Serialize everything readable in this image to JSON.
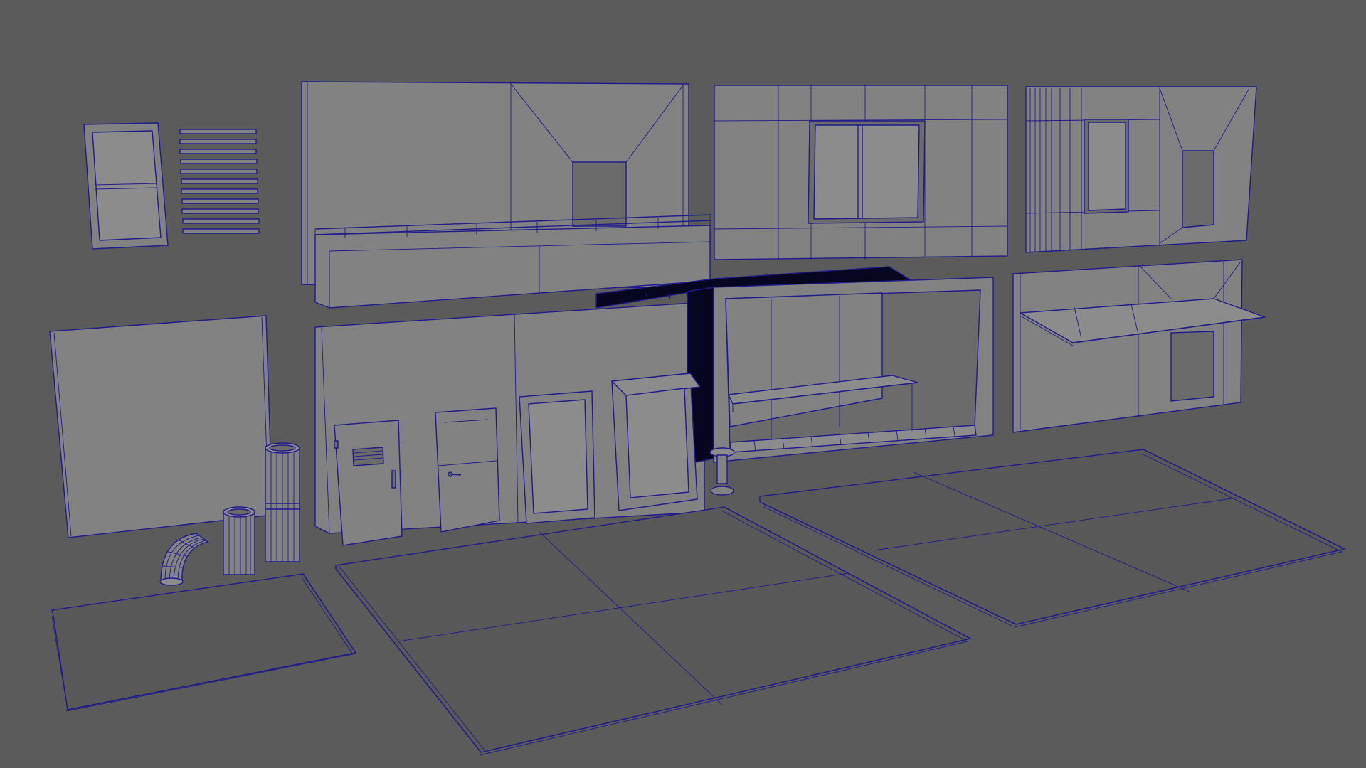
{
  "viewport": {
    "background_color": "#5b5b5b",
    "wire_color": "#1f1c8a",
    "surface_color": "#828282",
    "shadow_color": "#5a5a5a"
  },
  "objects": [
    "window-frame-piece",
    "vent-slat-panel",
    "balcony-facade-module",
    "central-window-facade-module",
    "right-facade-module",
    "awning-facade-module",
    "plain-wall-panel",
    "ground-floor-wall",
    "vented-door",
    "plain-door",
    "door-frame",
    "wall-cabinet",
    "canopy-beam",
    "bus-stop-shelter",
    "bench",
    "bollard",
    "pipe-elbow",
    "short-pipe",
    "tall-pipe",
    "ground-tile-left",
    "ground-tile-center",
    "ground-tile-right"
  ]
}
